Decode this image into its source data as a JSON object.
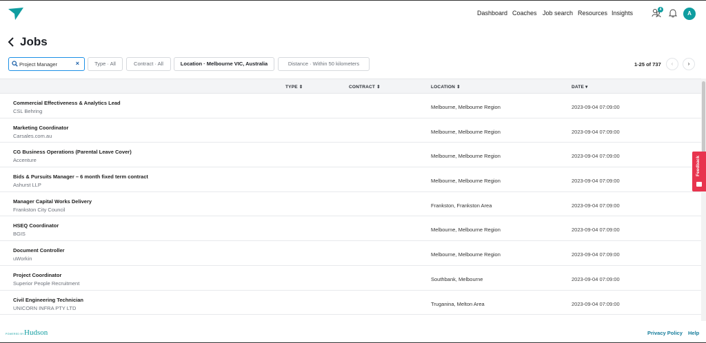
{
  "nav": {
    "items": [
      "Dashboard",
      "Coaches",
      "Job search",
      "Resources",
      "Insights"
    ],
    "notification_badge": "4",
    "avatar_initial": "A"
  },
  "page": {
    "title": "Jobs"
  },
  "filters": {
    "search_value": "Project Manager",
    "type": "Type · All",
    "contract": "Contract · All",
    "location": "Location · Melbourne VIC, Australia",
    "distance": "Distance · Within 50 kilometers"
  },
  "pagination": {
    "label": "1-25 of 737",
    "prev": "‹",
    "next": "›"
  },
  "table": {
    "headers": {
      "type": "TYPE ⇕",
      "contract": "CONTRACT ⇕",
      "location": "LOCATION ⇕",
      "date": "DATE ▾"
    },
    "rows": [
      {
        "title": "Commercial Effectiveness & Analytics Lead",
        "company": "CSL Behring",
        "location": "Melbourne, Melbourne Region",
        "date": "2023-09-04 07:09:00"
      },
      {
        "title": "Marketing Coordinator",
        "company": "Carsales.com.au",
        "location": "Melbourne, Melbourne Region",
        "date": "2023-09-04 07:09:00"
      },
      {
        "title": "CG Business Operations (Parental Leave Cover)",
        "company": "Accenture",
        "location": "Melbourne, Melbourne Region",
        "date": "2023-09-04 07:09:00"
      },
      {
        "title": "Bids & Pursuits Manager – 6 month fixed term contract",
        "company": "Ashurst LLP",
        "location": "Melbourne, Melbourne Region",
        "date": "2023-09-04 07:09:00"
      },
      {
        "title": "Manager Capital Works Delivery",
        "company": "Frankston City Council",
        "location": "Frankston, Frankston Area",
        "date": "2023-09-04 07:09:00"
      },
      {
        "title": "HSEQ Coordinator",
        "company": "BGIS",
        "location": "Melbourne, Melbourne Region",
        "date": "2023-09-04 07:09:00"
      },
      {
        "title": "Document Controller",
        "company": "uWorkin",
        "location": "Melbourne, Melbourne Region",
        "date": "2023-09-04 07:09:00"
      },
      {
        "title": "Project Coordinator",
        "company": "Superior People Recruitment",
        "location": "Southbank, Melbourne",
        "date": "2023-09-04 07:09:00"
      },
      {
        "title": "Civil Engineering Technician",
        "company": "UNICORN INFRA PTY LTD",
        "location": "Truganina, Melton Area",
        "date": "2023-09-04 07:09:00"
      }
    ]
  },
  "feedback": {
    "label": "Feedback"
  },
  "footer": {
    "powered_by": "POWERED BY",
    "brand": "Hudson",
    "privacy": "Privacy Policy",
    "help": "Help"
  },
  "colors": {
    "accent": "#0f9da0",
    "focus": "#1a8fe6",
    "feedback": "#e8344e",
    "link": "#157c9b"
  },
  "icons": [
    "logo-icon",
    "coaches-icon",
    "bell-icon",
    "back-arrow-icon",
    "search-icon",
    "clear-icon",
    "prev-icon",
    "next-icon",
    "feedback-icon"
  ]
}
